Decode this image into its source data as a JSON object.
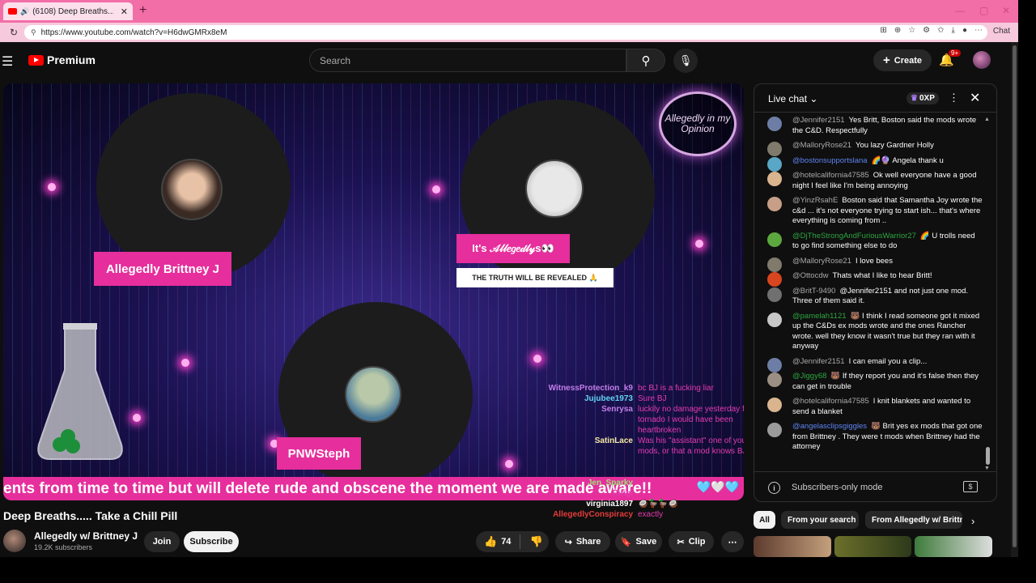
{
  "browser": {
    "tab_title": "(6108) Deep Breaths..... Take a",
    "tab_close": "✕",
    "new_tab": "+",
    "url": "https://www.youtube.com/watch?v=H6dwGMRx8eM",
    "chat_button": "Chat"
  },
  "header": {
    "logo_text": "Premium",
    "search_placeholder": "Search",
    "create_label": "Create",
    "notif_badge": "9+"
  },
  "video": {
    "host_label": "Allegedly Brittney J",
    "guest_label": "PNWSteph",
    "logo_text": "Allegedly in my Opinion",
    "banner_top": "It's 𝒜𝓁𝓁𝑒𝑔𝑒𝒹𝓁𝓎s👀",
    "banner_bottom": "THE TRUTH WILL BE REVEALED 🙏",
    "ticker": "ents from time to time but will delete rude and obscene the moment we are made aware!!",
    "ticker_hearts": "🩵🤍🩵",
    "overlay_chat": [
      {
        "name": "WitnessProtection_k9",
        "msg": "bc BJ is a fucking liar",
        "color": "#c27ee8"
      },
      {
        "name": "Jujubee1973",
        "msg": "Sure BJ",
        "color": "#61d3f2"
      },
      {
        "name": "Senrysa",
        "msg": "luckily no damage yesterday from tornado I would have been heartbroken",
        "color": "#c27ee8"
      },
      {
        "name": "SatinLace",
        "msg": "Was his \"assistant\" one of your mods, or that a mod knows BJ??",
        "color": "#f3e9a4"
      },
      {
        "name": "Jen_Sparky",
        "msg": "",
        "color": "#9be27b"
      },
      {
        "name": "Ririgi",
        "msg": "",
        "color": "#e43bb0"
      },
      {
        "name": "virginia1897",
        "msg": "🥥🦆🦆🥥",
        "color": "#ffffff"
      },
      {
        "name": "AllegedlyConspiracy",
        "msg": "exactly",
        "color": "#e43b3b"
      }
    ]
  },
  "meta": {
    "title": "Deep Breaths..... Take a Chill Pill",
    "channel": "Allegedly w/ Brittney J",
    "subscribers": "19.2K subscribers",
    "join": "Join",
    "subscribe": "Subscribe",
    "likes": "74",
    "share": "Share",
    "save": "Save",
    "clip": "Clip"
  },
  "chat": {
    "title": "Live chat",
    "xp": "0XP",
    "footer": "Subscribers-only mode",
    "messages": [
      {
        "name": "@Jennifer2151",
        "text": "Yes Britt, Boston said the mods wrote the C&D. Respectfully",
        "color": "#6d7ea6",
        "cls": ""
      },
      {
        "name": "@MalloryRose21",
        "text": "You lazy Gardner Holly",
        "color": "#7f7a6c",
        "cls": ""
      },
      {
        "name": "@bostonsupportslana",
        "text": "🌈🔮 Angela thank u",
        "color": "#5aa6c6",
        "cls": "blue"
      },
      {
        "name": "@hotelcalifornia47585",
        "text": "Ok well everyone have a good night I feel like I'm being annoying",
        "color": "#d9b48f",
        "cls": ""
      },
      {
        "name": "@YinzRsahE",
        "text": "Boston said that Samantha Joy wrote the c&d ... it's not everyone trying to start ish... that's where everything is coming from ..",
        "color": "#c79f86",
        "cls": ""
      },
      {
        "name": "@DjTheStrongAndFuriousWarrior27",
        "text": "🌈 U trolls need to go find something else to do",
        "color": "#5ca83f",
        "cls": "green"
      },
      {
        "name": "@MalloryRose21",
        "text": "I love bees",
        "color": "#7f7a6c",
        "cls": ""
      },
      {
        "name": "@Ottocdw",
        "text": "Thats what I like to hear Britt!",
        "color": "#d8451f",
        "cls": ""
      },
      {
        "name": "@BritT-9490",
        "text": "@Jennifer2151 and not just one mod. Three of them said it.",
        "color": "#707070",
        "cls": ""
      },
      {
        "name": "@pamelah1121",
        "text": "🐻 I think I read someone got it mixed up the C&Ds ex mods wrote and the ones Rancher wrote. well they know it wasn't true but they ran with it anyway",
        "color": "#c7c7c7",
        "cls": "green"
      },
      {
        "name": "@Jennifer2151",
        "text": "I can email you a clip...",
        "color": "#6d7ea6",
        "cls": ""
      },
      {
        "name": "@Jiggy68",
        "text": "🐻 If they report you and it's false then they can get in trouble",
        "color": "#9a8f82",
        "cls": "green"
      },
      {
        "name": "@hotelcalifornia47585",
        "text": "I knit blankets and wanted to send a blanket",
        "color": "#d9b48f",
        "cls": ""
      },
      {
        "name": "@angelasclipsgiggles",
        "text": "🐻 Brit yes ex mods that got one from Brittney . They were t mods when Brittney had the attorney",
        "color": "#9b9b9b",
        "cls": "blue"
      }
    ]
  },
  "chips": [
    "All",
    "From your search",
    "From Allegedly w/ Brittney J"
  ]
}
